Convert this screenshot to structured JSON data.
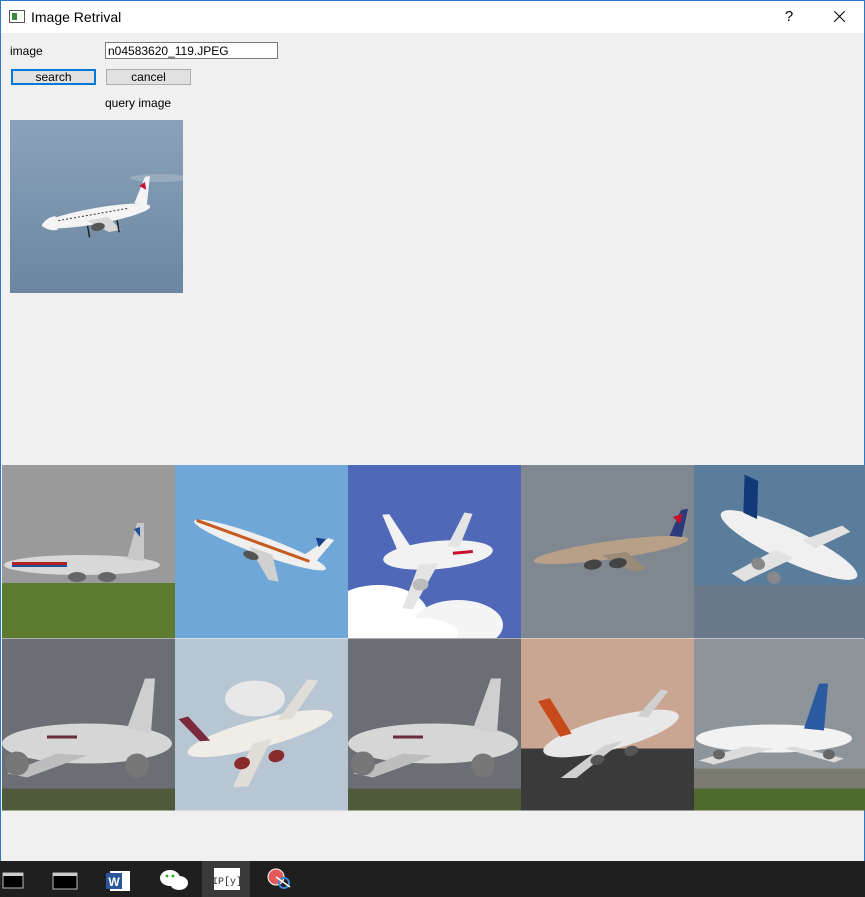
{
  "window": {
    "title": "Image Retrival"
  },
  "title_buttons": {
    "help": "?"
  },
  "form": {
    "image_label": "image",
    "image_value": "n04583620_119.JPEG",
    "search_label": "search",
    "cancel_label": "cancel",
    "query_label": "query image"
  },
  "query_image": {
    "subject": "airliner",
    "livery": "Air Canada",
    "sky": "#6f8ba6"
  },
  "results": [
    {
      "subject": "airliner",
      "livery": "American",
      "sky": "#8f8f8f"
    },
    {
      "subject": "airliner",
      "livery": "United",
      "sky": "#6fa7d8"
    },
    {
      "subject": "airliner",
      "livery": "white",
      "sky": "#5570c0"
    },
    {
      "subject": "airliner",
      "livery": "Aeroflot",
      "sky": "#7f8890"
    },
    {
      "subject": "airliner",
      "livery": "Airbus",
      "sky": "#5b7d9c"
    },
    {
      "subject": "airliner",
      "livery": "Qatar",
      "sky": "#6b6e74"
    },
    {
      "subject": "airliner",
      "livery": "Qatar",
      "sky": "#b8c6d4"
    },
    {
      "subject": "airliner",
      "livery": "Qatar",
      "sky": "#6b6e74"
    },
    {
      "subject": "airliner",
      "livery": "747",
      "sky": "#c9a592"
    },
    {
      "subject": "airliner",
      "livery": "747",
      "sky": "#8e959a"
    }
  ],
  "taskbar": {
    "items": [
      "cmd-icon",
      "cmd-icon",
      "word-icon",
      "wechat-icon",
      "ipython-icon",
      "snipping-icon"
    ],
    "active_index": 4
  }
}
